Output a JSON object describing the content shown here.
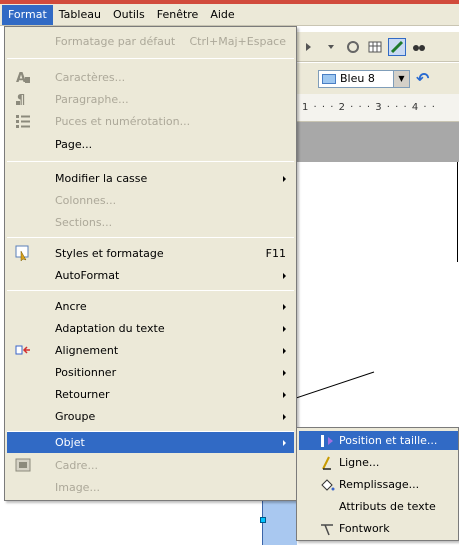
{
  "menubar": {
    "items": [
      {
        "label": "Format",
        "active": true
      },
      {
        "label": "Tableau"
      },
      {
        "label": "Outils"
      },
      {
        "label": "Fenêtre"
      },
      {
        "label": "Aide"
      }
    ]
  },
  "toolbar": {
    "style_value": "Bleu 8",
    "ruler_text": "1 · · · 2 · · · 3 · · · 4 · ·"
  },
  "format_menu": {
    "items": [
      {
        "label": "Formatage par défaut",
        "shortcut": "Ctrl+Maj+Espace",
        "disabled": true
      },
      {
        "label": "Caractères...",
        "disabled": true,
        "icon": "character-icon"
      },
      {
        "label": "Paragraphe...",
        "disabled": true,
        "icon": "paragraph-icon"
      },
      {
        "label": "Puces et numérotation...",
        "disabled": true,
        "icon": "bullets-icon"
      },
      {
        "label": "Page..."
      },
      {
        "label": "Modifier la casse",
        "submenu": true
      },
      {
        "label": "Colonnes...",
        "disabled": true
      },
      {
        "label": "Sections...",
        "disabled": true
      },
      {
        "label": "Styles et formatage",
        "shortcut": "F11",
        "icon": "styles-icon"
      },
      {
        "label": "AutoFormat",
        "submenu": true
      },
      {
        "label": "Ancre",
        "submenu": true
      },
      {
        "label": "Adaptation du texte",
        "submenu": true
      },
      {
        "label": "Alignement",
        "submenu": true,
        "icon": "alignment-icon"
      },
      {
        "label": "Positionner",
        "submenu": true
      },
      {
        "label": "Retourner",
        "submenu": true
      },
      {
        "label": "Groupe",
        "submenu": true
      },
      {
        "label": "Objet",
        "submenu": true,
        "highlight": true
      },
      {
        "label": "Cadre...",
        "disabled": true,
        "icon": "frame-icon"
      },
      {
        "label": "Image...",
        "disabled": true
      }
    ]
  },
  "object_submenu": {
    "items": [
      {
        "label": "Position et taille...",
        "highlight": true,
        "icon": "position-size-icon"
      },
      {
        "label": "Ligne...",
        "icon": "line-icon"
      },
      {
        "label": "Remplissage...",
        "icon": "fill-icon"
      },
      {
        "label": "Attributs de texte"
      },
      {
        "label": "Fontwork",
        "icon": "fontwork-icon"
      }
    ]
  },
  "colors": {
    "highlight": "#316ac5",
    "menu_bg": "#ece9d8",
    "disabled_text": "#aca899"
  }
}
